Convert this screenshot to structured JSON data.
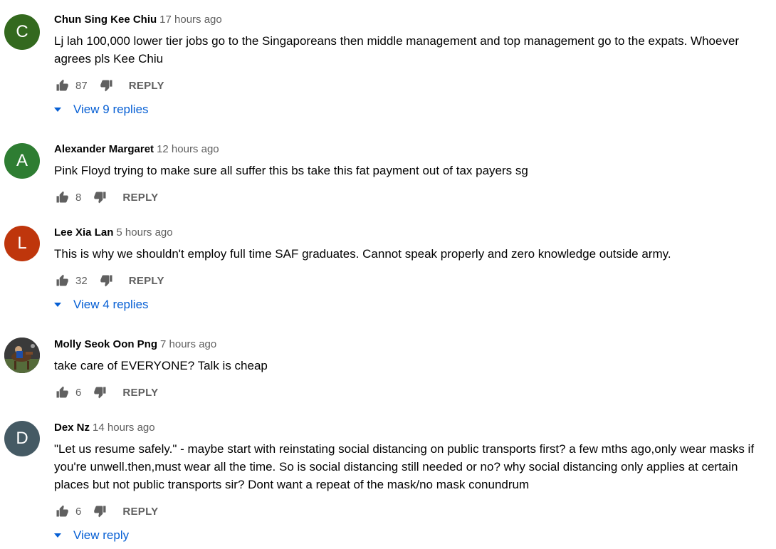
{
  "colors": {
    "author": "#030303",
    "meta": "#606060",
    "link": "#065fd4"
  },
  "comments": [
    {
      "author": "Chun Sing Kee Chiu",
      "time": "17 hours ago",
      "avatar_letter": "C",
      "avatar_color": "#33691e",
      "text": "Lj lah 100,000 lower tier jobs go to the Singaporeans then middle management and top management go to the expats. Whoever agrees pls Kee Chiu",
      "likes": "87",
      "reply_label": "REPLY",
      "view_replies": "View 9 replies"
    },
    {
      "author": "Alexander Margaret",
      "time": "12 hours ago",
      "avatar_letter": "A",
      "avatar_color": "#2e7d32",
      "text": "Pink Floyd trying to make sure all suffer this bs take this fat payment out of tax payers sg",
      "likes": "8",
      "reply_label": "REPLY"
    },
    {
      "author": "Lee Xia Lan",
      "time": "5 hours ago",
      "avatar_letter": "L",
      "avatar_color": "#bf360c",
      "text": "This is why we shouldn't employ full time SAF graduates. Cannot speak properly and zero knowledge outside army.",
      "likes": "32",
      "reply_label": "REPLY",
      "view_replies": "View 4 replies"
    },
    {
      "author": "Molly Seok Oon Png",
      "time": "7 hours ago",
      "avatar_icon": "photo-avatar",
      "text": "take care of EVERYONE? Talk is cheap",
      "likes": "6",
      "reply_label": "REPLY"
    },
    {
      "author": "Dex Nz",
      "time": "14 hours ago",
      "avatar_letter": "D",
      "avatar_color": "#455a64",
      "text": "\"Let us resume safely.\" - maybe start with reinstating social distancing on public transports first? a few mths ago,only wear masks if you're unwell.then,must wear all the time. So is social distancing still needed or no? why social distancing only applies at certain places but not public transports sir? Dont want a repeat of the mask/no mask conundrum",
      "likes": "6",
      "reply_label": "REPLY",
      "view_replies": "View reply"
    }
  ]
}
